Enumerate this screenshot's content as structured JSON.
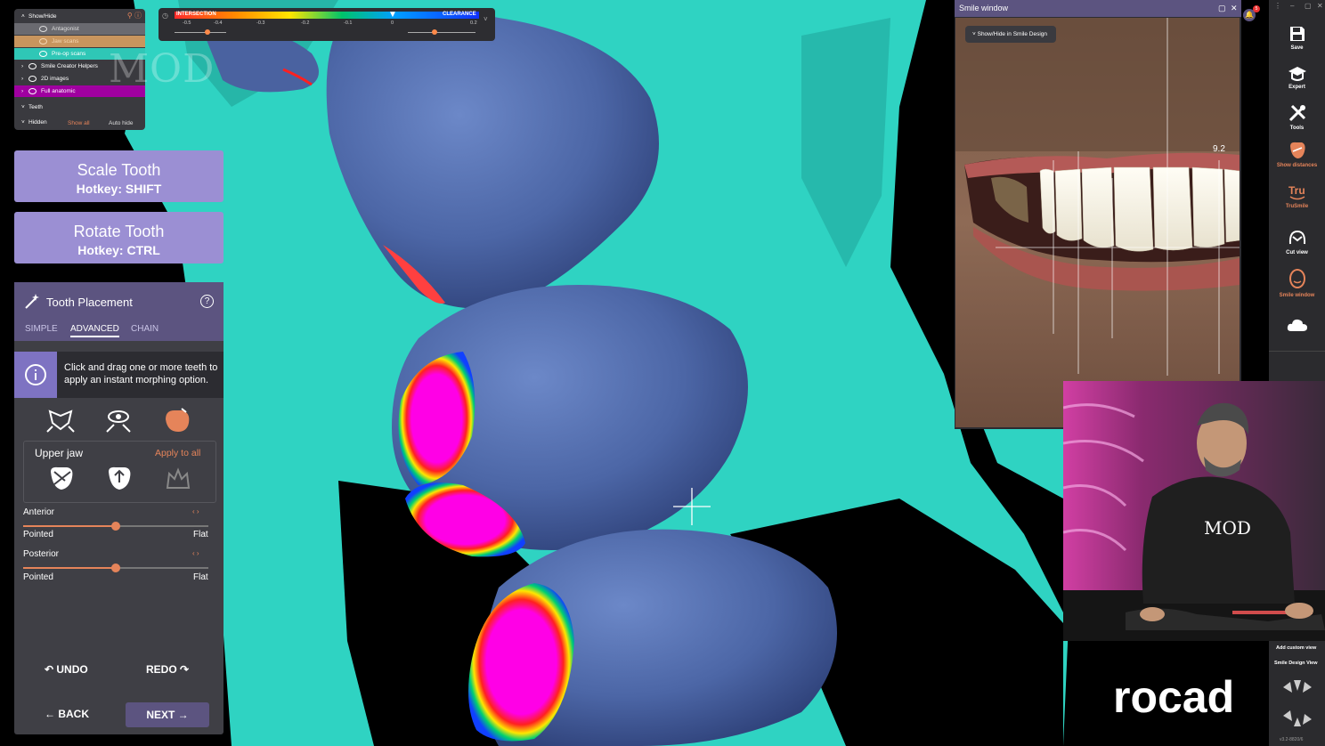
{
  "colors": {
    "accent": "#9b8fd3",
    "header": "#5c5480",
    "panel": "#3f3f45",
    "slider": "#e5845a",
    "gum": "#2fd3c2",
    "tooth": "#4f6aa8"
  },
  "show_hide": {
    "title": "Show/Hide",
    "items": [
      {
        "label": "Antagonist",
        "state": "visible-muted"
      },
      {
        "label": "Jaw scans",
        "state": "selected-orange"
      },
      {
        "label": "Pre-op scans",
        "state": "selected-teal"
      },
      {
        "label": "Smile Creator Helpers",
        "state": "visible"
      },
      {
        "label": "2D images",
        "state": "visible"
      },
      {
        "label": "Full anatomic",
        "state": "selected-magenta"
      }
    ],
    "teeth_label": "Teeth",
    "hidden_label": "Hidden",
    "show_all": "Show all",
    "auto_hide": "Auto hide"
  },
  "watermark": "MOD",
  "clearance": {
    "left_label": "INTERSECTION",
    "right_label": "CLEARANCE",
    "ticks": [
      "-0.5",
      "-0.4",
      "-0.3",
      "-0.2",
      "-0.1",
      "0",
      "0.2"
    ]
  },
  "scale_tooth": {
    "title": "Scale Tooth",
    "hotkey": "Hotkey: SHIFT"
  },
  "rotate_tooth": {
    "title": "Rotate Tooth",
    "hotkey": "Hotkey: CTRL"
  },
  "tooth_placement": {
    "title": "Tooth Placement",
    "help": "?",
    "tabs": [
      "SIMPLE",
      "ADVANCED",
      "CHAIN"
    ],
    "active_tab": "ADVANCED",
    "info_text": "Click and drag one or more teeth to apply an instant morphing option.",
    "mode_icons": [
      "move-teeth-icon",
      "view-transform-icon",
      "morph-tooth-icon"
    ],
    "jaw_label": "Upper jaw",
    "apply_all": "Apply to all",
    "jaw_icons": [
      "tooth-cut-icon",
      "tooth-up-icon",
      "crown-icon"
    ],
    "sliders": [
      {
        "name": "Anterior",
        "left": "Pointed",
        "right": "Flat",
        "value": 0.5
      },
      {
        "name": "Posterior",
        "left": "Pointed",
        "right": "Flat",
        "value": 0.5
      }
    ],
    "undo": "UNDO",
    "redo": "REDO",
    "back": "BACK",
    "next": "NEXT"
  },
  "smile_window": {
    "title": "Smile window",
    "toggle": "Show/Hide in Smile Design",
    "measure": "9.2"
  },
  "toolbar": {
    "items": [
      {
        "label": "Save",
        "icon": "save-icon"
      },
      {
        "label": "Expert",
        "icon": "graduation-cap-icon"
      },
      {
        "label": "Tools",
        "icon": "tools-icon"
      },
      {
        "label": "Show distances",
        "icon": "distances-icon"
      },
      {
        "label": "TruSmile",
        "icon": "trusmile-icon"
      },
      {
        "label": "Cut view",
        "icon": "cut-view-icon"
      },
      {
        "label": "Smile window",
        "icon": "smile-face-icon"
      },
      {
        "label": "",
        "icon": "cloud-icon"
      }
    ],
    "add_custom_view": "Add custom view",
    "smile_design_view": "Smile Design View",
    "version": "v3.2-8820/6"
  },
  "brand_text": "rocad",
  "notification_count": "5"
}
